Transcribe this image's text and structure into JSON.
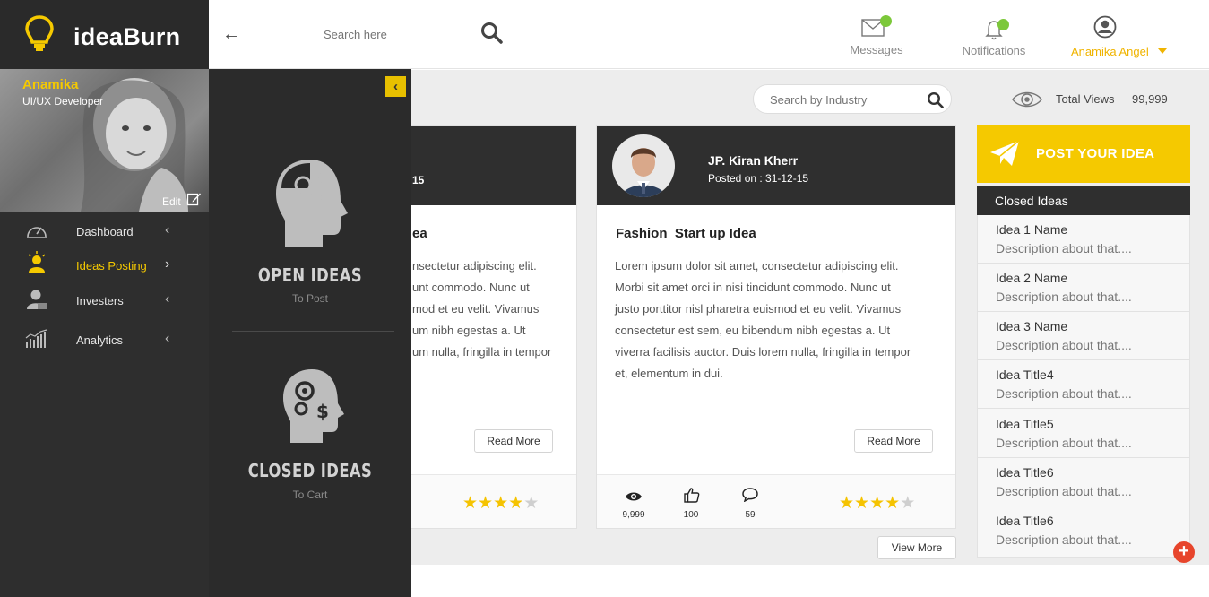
{
  "app": {
    "brand": "ideaBurn"
  },
  "profile": {
    "name": "Anamika",
    "role": "UI/UX  Developer",
    "edit_label": "Edit"
  },
  "nav": [
    {
      "label": "Dashboard",
      "icon": "gauge-icon"
    },
    {
      "label": "Ideas Posting",
      "icon": "idea-person-icon",
      "active": true
    },
    {
      "label": "Investers",
      "icon": "investor-icon"
    },
    {
      "label": "Analytics",
      "icon": "analytics-icon"
    }
  ],
  "drawer": {
    "open": {
      "title": "OPEN IDEAS",
      "subtitle": "To Post"
    },
    "closed": {
      "title": "CLOSED IDEAS",
      "subtitle": "To Cart"
    }
  },
  "topbar": {
    "search_placeholder": "Search here",
    "messages_label": "Messages",
    "notifications_label": "Notifications",
    "user_name": "Anamika Angel"
  },
  "toolbar": {
    "industry_placeholder": "Search by Industry",
    "total_views_label": "Total Views",
    "total_views_value": "99,999"
  },
  "cards": [
    {
      "date_fragment": "15",
      "title_fragment": "ea",
      "body_lines": [
        "nsectetur adipiscing elit.",
        "unt commodo. Nunc ut",
        "mod et eu velit. Vivamus",
        "um nibh egestas a. Ut",
        "um nulla, fringilla in tempor"
      ],
      "read_more": "Read More",
      "rating": 4
    },
    {
      "author": "JP. Kiran Kherr",
      "posted": "Posted on : 31-12-15",
      "title": "Fashion  Start up Idea",
      "body_lines": [
        "Lorem ipsum dolor sit amet, consectetur adipiscing elit.",
        "Morbi sit amet orci in nisi tincidunt commodo. Nunc ut",
        "justo porttitor nisl pharetra euismod et eu velit. Vivamus",
        "consectetur est sem, eu bibendum nibh egestas a. Ut",
        "viverra facilisis auctor. Duis lorem nulla, fringilla in tempor",
        "et, elementum in dui."
      ],
      "read_more": "Read More",
      "views": "9,999",
      "likes": "100",
      "comments": "59",
      "rating": 4
    }
  ],
  "view_more": "View More",
  "post_idea": "POST YOUR IDEA",
  "closed_ideas": {
    "title": "Closed Ideas",
    "items": [
      {
        "name": "Idea 1 Name",
        "desc": "Description about that...."
      },
      {
        "name": "Idea 2 Name",
        "desc": "Description about that...."
      },
      {
        "name": "Idea 3 Name",
        "desc": "Description about that...."
      },
      {
        "name": "Idea Title4",
        "desc": "Description about that...."
      },
      {
        "name": "Idea Title5",
        "desc": "Description about that...."
      },
      {
        "name": "Idea Title6",
        "desc": "Description about that...."
      },
      {
        "name": "Idea Title6",
        "desc": "Description about that...."
      }
    ]
  },
  "colors": {
    "accent": "#f5c900",
    "dark": "#2e2e2e",
    "fab": "#e7452c",
    "online": "#7cc83a"
  }
}
